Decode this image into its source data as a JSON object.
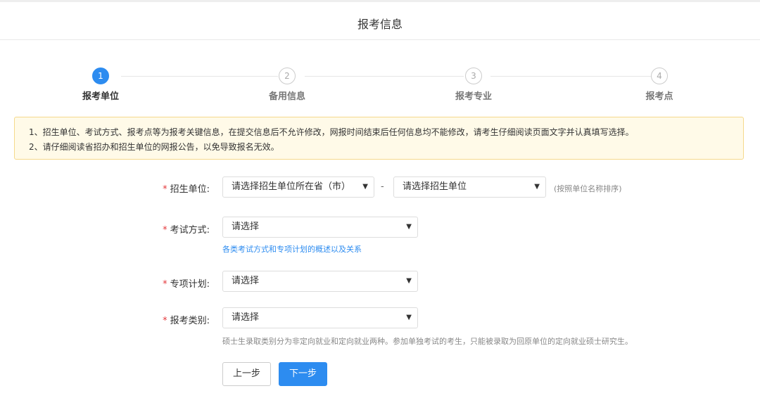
{
  "header": {
    "title": "报考信息"
  },
  "steps": [
    {
      "number": "1",
      "label": "报考单位"
    },
    {
      "number": "2",
      "label": "备用信息"
    },
    {
      "number": "3",
      "label": "报考专业"
    },
    {
      "number": "4",
      "label": "报考点"
    }
  ],
  "active_step": 1,
  "notice": {
    "line1": "1、招生单位、考试方式、报考点等为报考关键信息，在提交信息后不允许修改，网报时间结束后任何信息均不能修改，请考生仔细阅读页面文字并认真填写选择。",
    "line2": "2、请仔细阅读省招办和招生单位的网报公告，以免导致报名无效。"
  },
  "form": {
    "required_mark": "*",
    "unit": {
      "label": "招生单位:",
      "province_select": "请选择招生单位所在省（市）",
      "separator": "-",
      "unit_select": "请选择招生单位",
      "hint": "(按照单位名称排序)"
    },
    "exam_method": {
      "label": "考试方式:",
      "select": "请选择",
      "link": "各类考试方式和专项计划的概述以及关系"
    },
    "special_plan": {
      "label": "专项计划:",
      "select": "请选择"
    },
    "category": {
      "label": "报考类别:",
      "select": "请选择",
      "hint": "硕士生录取类别分为非定向就业和定向就业两种。参加单独考试的考生，只能被录取为回原单位的定向就业硕士研究生。"
    }
  },
  "buttons": {
    "prev": "上一步",
    "next": "下一步"
  },
  "colors": {
    "accent": "#2d8cf0",
    "required": "#e4393c",
    "notice_bg": "#fffae8",
    "notice_border": "#f5d98c"
  },
  "icons": {
    "select_arrow": "dropdown-arrow-icon"
  }
}
